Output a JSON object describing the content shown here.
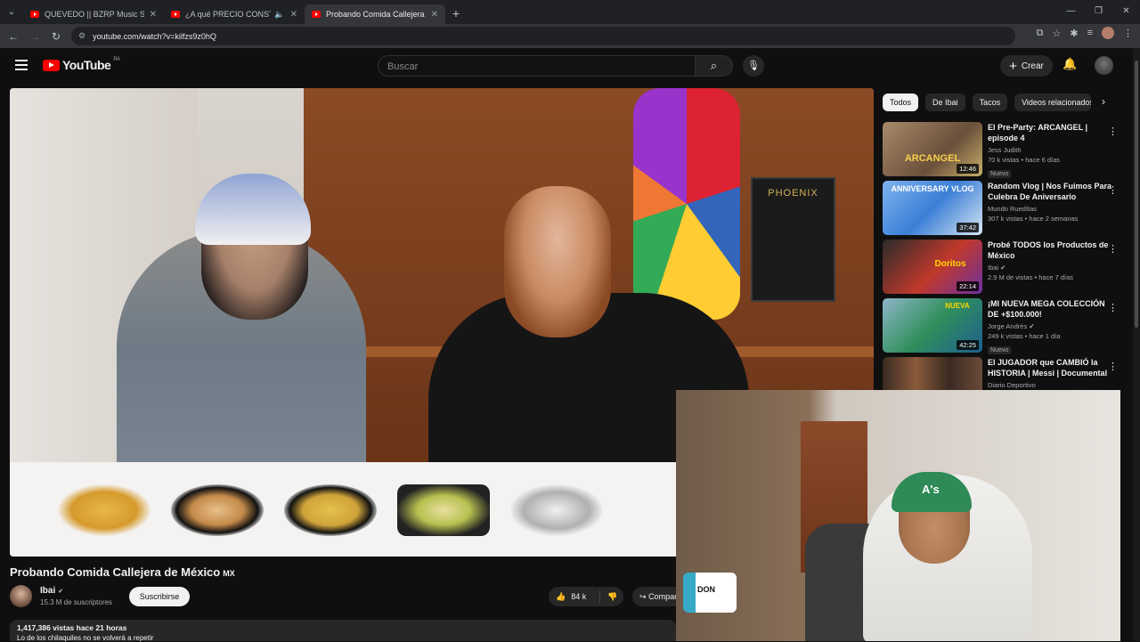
{
  "browser": {
    "tabs": [
      {
        "title": "QUEVEDO || BZRP Music Sessio",
        "active": false,
        "audio": false
      },
      {
        "title": "¿A qué PRECIO CONSTRUYÓ C",
        "active": false,
        "audio": true
      },
      {
        "title": "Probando Comida Callejera",
        "active": true,
        "audio": false
      }
    ],
    "url": "youtube.com/watch?v=kilfzs9z0hQ",
    "new_tab": "+"
  },
  "header": {
    "logo_text": "YouTube",
    "country": "PA",
    "search_placeholder": "Buscar",
    "create_label": "Crear"
  },
  "video": {
    "title": "Probando Comida Callejera de México",
    "title_flag": "MX",
    "book_text": "PHOENIX",
    "channel": "Ibai",
    "subscribers": "15.3 M de suscriptores",
    "subscribe_label": "Suscribirse",
    "likes": "84 k",
    "share_label": "Compartir",
    "views_date": "1,417,386 vistas  hace 21 horas",
    "description": "Lo de los chilaquiles no se volverá a repetir"
  },
  "facecam": {
    "cap_logo": "A's",
    "mug_text": "DON"
  },
  "chips": [
    "Todos",
    "De Ibai",
    "Tacos",
    "Videos relacionados"
  ],
  "recommendations": [
    {
      "title": "El Pre-Party: ARCANGEL | episode 4",
      "channel": "Jess Judith",
      "verified": false,
      "meta": "70 k vistas • hace 6 días",
      "badge": "Nuevo",
      "duration": "12:46",
      "thumb_text": "ARCANGEL",
      "thumb_color": "#c8b06a"
    },
    {
      "title": "Random Vlog | Nos Fuimos Para Culebra De Aniversario",
      "channel": "Mundo Ruedítas",
      "verified": false,
      "meta": "307 k vistas • hace 2 semanas",
      "badge": "",
      "duration": "37:42",
      "thumb_text": "ANNIVERSARY VLOG",
      "thumb_color": "#3b7fd6"
    },
    {
      "title": "Probé TODOS los Productos de México",
      "channel": "Ibai",
      "verified": true,
      "meta": "2.9 M de vistas • hace 7 días",
      "badge": "",
      "duration": "22:14",
      "thumb_text": "Doritos",
      "thumb_color": "#c0392b"
    },
    {
      "title": "¡MI NUEVA MEGA COLECCIÓN DE +$100.000!",
      "channel": "Jorge Andrés",
      "verified": true,
      "meta": "249 k vistas • hace 1 día",
      "badge": "Nuevo",
      "duration": "42:25",
      "thumb_text": "NUEVA",
      "thumb_color": "#2f8f5b"
    },
    {
      "title": "El JUGADOR que CAMBIÓ la HISTORIA | Messi | Documental",
      "channel": "Diario Deportivo",
      "verified": false,
      "meta": "",
      "badge": "",
      "duration": "",
      "thumb_text": "",
      "thumb_color": "#6b4b3a"
    }
  ]
}
